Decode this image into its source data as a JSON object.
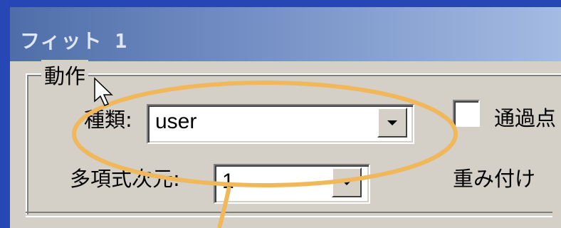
{
  "window": {
    "title": "フィット 1"
  },
  "group": {
    "title": "動作"
  },
  "type_field": {
    "label": "種類:",
    "value": "user"
  },
  "degree_field": {
    "label": "多項式次元:",
    "value": "1"
  },
  "pass_through": {
    "label": "通過点"
  },
  "weighting": {
    "label": "重み付け"
  },
  "colors": {
    "highlight": "#f0b85a",
    "titlebar": "#4f6ea9",
    "desktop": "#1f3fa8",
    "dialog": "#d4d0c8"
  }
}
